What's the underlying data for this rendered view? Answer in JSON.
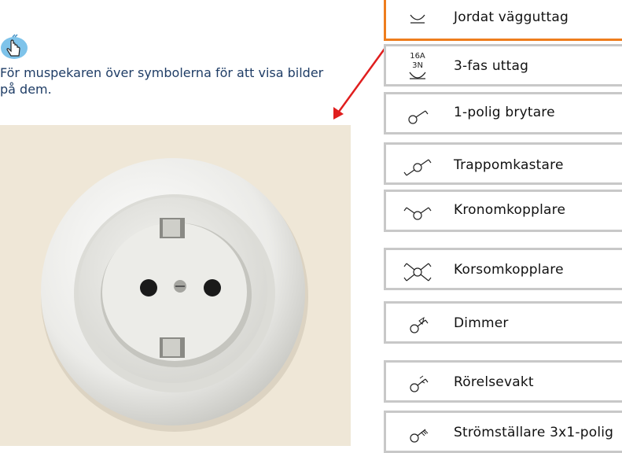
{
  "instruction": {
    "icon": "pointer-hand-icon",
    "text": "För muspekaren över symbolerna för att visa bilder på dem."
  },
  "preview": {
    "subject": "socket-photo",
    "background_color": "#efe7d7"
  },
  "symbols": {
    "active_color": "#ee7d1d",
    "items": [
      {
        "label": "Jordat vägguttag",
        "icon": "grounded-socket-symbol-icon"
      },
      {
        "label": "3-fas uttag",
        "icon": "three-phase-socket-symbol-icon",
        "icon_text_top": "16A",
        "icon_text_bottom": "3N"
      },
      {
        "label": "1-polig brytare",
        "icon": "single-pole-switch-symbol-icon"
      },
      {
        "label": "Trappomkastare",
        "icon": "two-way-switch-symbol-icon"
      },
      {
        "label": "Kronomkopplare",
        "icon": "chandelier-switch-symbol-icon"
      },
      {
        "label": "Korsomkopplare",
        "icon": "intermediate-switch-symbol-icon"
      },
      {
        "label": "Dimmer",
        "icon": "dimmer-symbol-icon"
      },
      {
        "label": "Rörelsevakt",
        "icon": "motion-sensor-symbol-icon"
      },
      {
        "label": "Strömställare 3x1-polig",
        "icon": "triple-pole-switch-symbol-icon"
      }
    ]
  }
}
